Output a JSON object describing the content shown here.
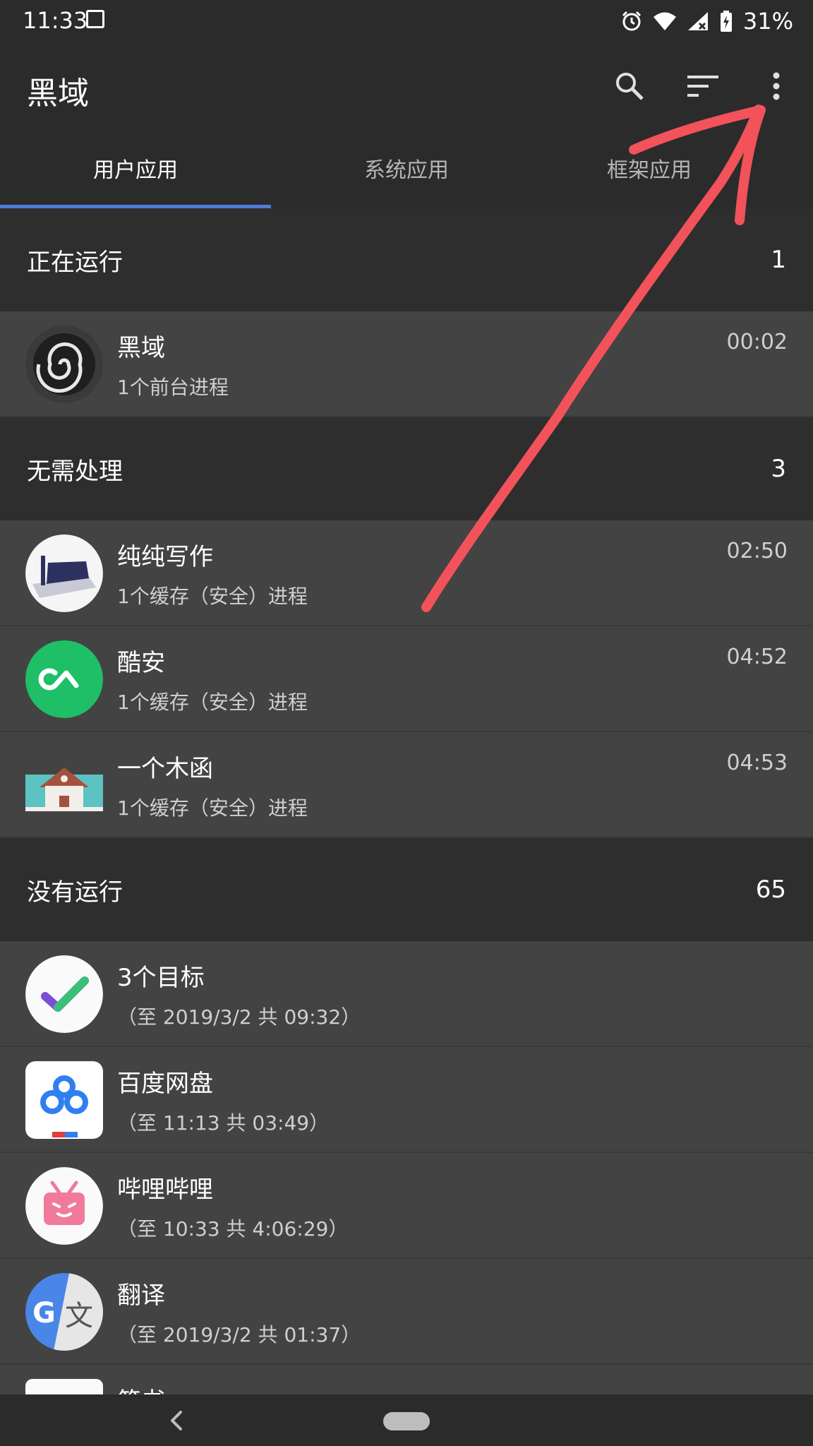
{
  "status_bar": {
    "time": "11:33",
    "battery": "31%"
  },
  "app_bar": {
    "title": "黑域",
    "actions": [
      "search-icon",
      "sort-icon",
      "more-vert-icon"
    ]
  },
  "tabs": [
    {
      "label": "用户应用",
      "active": true
    },
    {
      "label": "系统应用",
      "active": false
    },
    {
      "label": "框架应用",
      "active": false
    }
  ],
  "sections": [
    {
      "title": "正在运行",
      "count": "1",
      "items": [
        {
          "name": "黑域",
          "sub": "1个前台进程",
          "time": "00:02"
        }
      ]
    },
    {
      "title": "无需处理",
      "count": "3",
      "items": [
        {
          "name": "纯纯写作",
          "sub": "1个缓存（安全）进程",
          "time": "02:50"
        },
        {
          "name": "酷安",
          "sub": "1个缓存（安全）进程",
          "time": "04:52"
        },
        {
          "name": "一个木函",
          "sub": "1个缓存（安全）进程",
          "time": "04:53"
        }
      ]
    },
    {
      "title": "没有运行",
      "count": "65",
      "items": [
        {
          "name": "3个目标",
          "sub": "（至 2019/3/2 共 09:32）"
        },
        {
          "name": "百度网盘",
          "sub": "（至 11:13 共 03:49）"
        },
        {
          "name": "哔哩哔哩",
          "sub": "（至 10:33 共 4:06:29）"
        },
        {
          "name": "翻译",
          "sub": "（至 2019/3/2 共 01:37）"
        },
        {
          "name": "简书"
        }
      ]
    }
  ],
  "colors": {
    "accent": "#4d7cd9",
    "annotation": "#f2525a"
  }
}
